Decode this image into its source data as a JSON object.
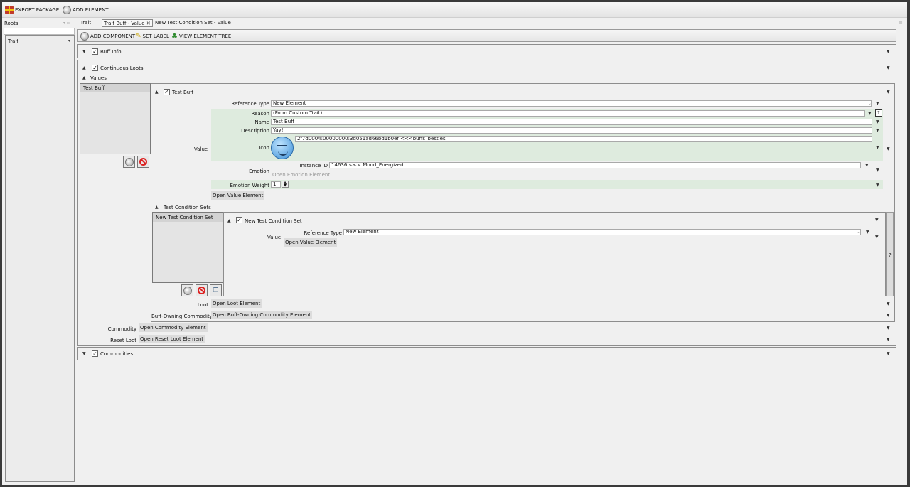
{
  "toolbar": {
    "export_label": "EXPORT PACKAGE",
    "add_element_label": "ADD ELEMENT"
  },
  "sidebar": {
    "header": "Roots",
    "selected": "Trait"
  },
  "tabs": [
    {
      "label": "Trait"
    },
    {
      "label": "Trait Buff - Value"
    },
    {
      "label": "New Test Condition Set - Value"
    }
  ],
  "component_toolbar": {
    "add_component": "ADD COMPONENT",
    "set_label": "SET LABEL",
    "view_tree": "VIEW ELEMENT TREE"
  },
  "sections": {
    "buff_info": "Buff Info",
    "continuous_loots": "Continuous Loots",
    "values": "Values",
    "commodities": "Commodities"
  },
  "values_list": {
    "item": "Test Buff"
  },
  "test_buff": {
    "title": "Test Buff",
    "value_label": "Value",
    "reference_type_label": "Reference Type",
    "reference_type": "New Element",
    "reason_label": "Reason",
    "reason": "(From Custom Trait)",
    "name_label": "Name",
    "name": "Test Buff",
    "description_label": "Description",
    "description": "Yay!",
    "icon_label": "Icon",
    "icon_value": "2f7d0004:00000000:3d051ad66bd1b0ef <<<buffs_besties",
    "emotion_label": "Emotion",
    "instance_id_label": "Instance ID",
    "instance_id": "14636 <<< Mood_Energized",
    "open_emotion": "Open Emotion Element",
    "emotion_weight_label": "Emotion Weight",
    "emotion_weight": "1",
    "open_value": "Open Value Element",
    "help": "?"
  },
  "test_condition_sets": {
    "header": "Test Condition Sets",
    "list_item": "New Test Condition Set",
    "title": "New Test Condition Set",
    "value_label": "Value",
    "reference_type_label": "Reference Type",
    "reference_type": "New Element",
    "open_value": "Open Value Element",
    "scroll_marker": "?"
  },
  "loot": {
    "label": "Loot",
    "button": "Open Loot Element"
  },
  "buff_owning": {
    "label": "Buff-Owning Commodity",
    "button": "Open Buff-Owning Commodity Element"
  },
  "commodity": {
    "label": "Commodity",
    "button": "Open Commodity Element"
  },
  "reset_loot": {
    "label": "Reset Loot",
    "button": "Open Reset Loot Element"
  },
  "colors": {
    "row_highlight": "#deebde",
    "panel_bg": "#f0f0f0",
    "ban_red": "#dd2222"
  }
}
